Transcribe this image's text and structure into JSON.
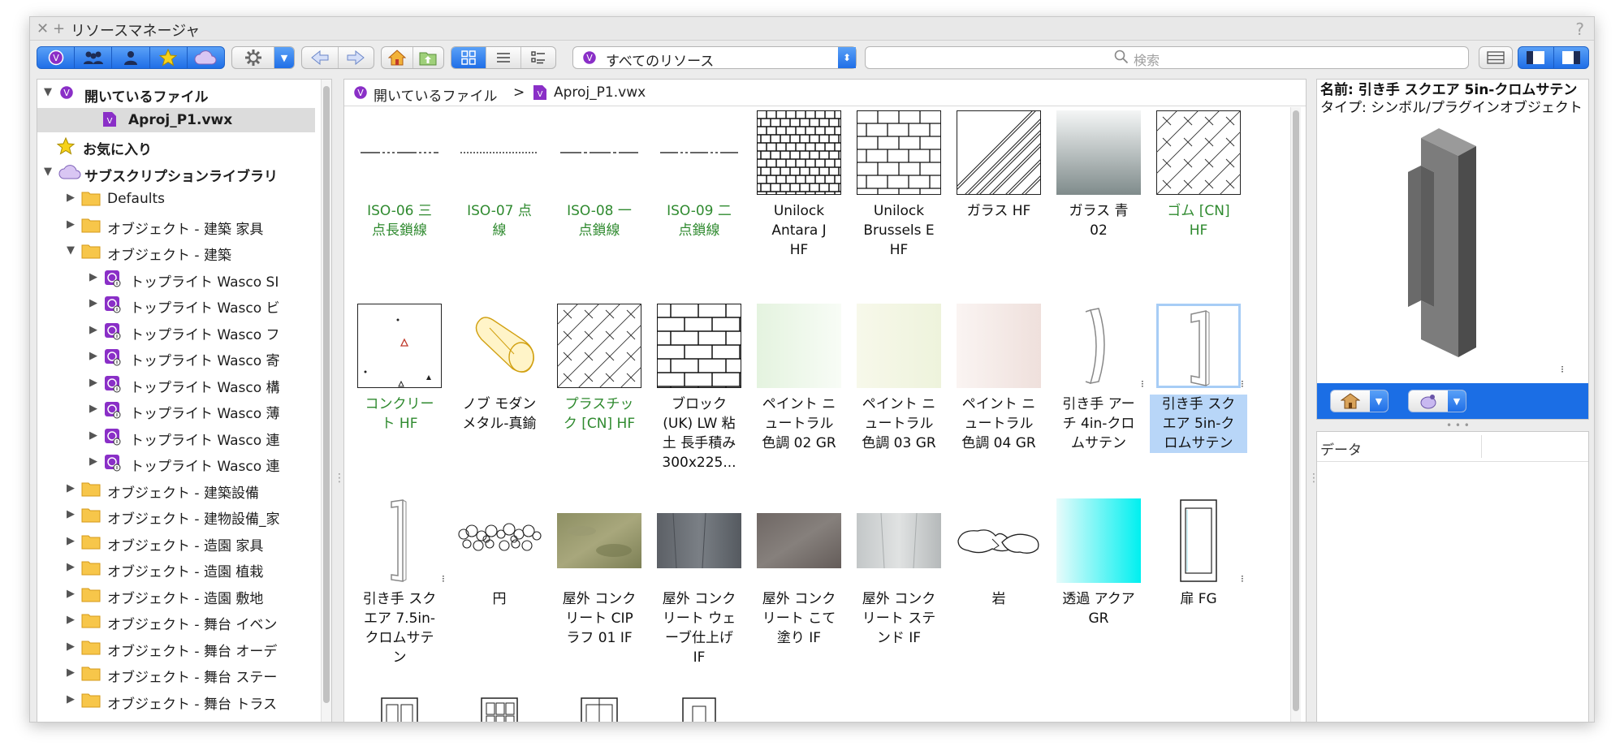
{
  "window": {
    "title": "リソースマネージャ",
    "help": "?"
  },
  "toolbar": {
    "filter_label": "すべてのリソース",
    "search_placeholder": "検索"
  },
  "breadcrumb": {
    "root": "開いているファイル",
    "sep": ">",
    "file": "Aproj_P1.vwx"
  },
  "tree": [
    {
      "label": "開いているファイル",
      "bold": true,
      "level": 0,
      "expanded": true,
      "icon": "vw-file-icon"
    },
    {
      "label": "Aproj_P1.vwx",
      "bold": true,
      "level": 1,
      "selected": true,
      "icon": "vw-doc-icon"
    },
    {
      "label": "お気に入り",
      "bold": true,
      "level": 0,
      "icon": "star-icon"
    },
    {
      "label": "サブスクリプションライブラリ",
      "bold": true,
      "level": 0,
      "expanded": true,
      "icon": "cloud-icon"
    },
    {
      "label": "Defaults",
      "level": 1,
      "icon": "folder-icon"
    },
    {
      "label": "オブジェクト - 建築 家具",
      "level": 1,
      "icon": "folder-icon"
    },
    {
      "label": "オブジェクト - 建築",
      "level": 1,
      "expanded": true,
      "icon": "folder-icon"
    },
    {
      "label": "トップライト Wasco SI",
      "level": 2,
      "icon": "vw-lib-icon"
    },
    {
      "label": "トップライト Wasco ビ",
      "level": 2,
      "icon": "vw-lib-icon"
    },
    {
      "label": "トップライト Wasco フ",
      "level": 2,
      "icon": "vw-lib-icon"
    },
    {
      "label": "トップライト Wasco 寄",
      "level": 2,
      "icon": "vw-lib-icon"
    },
    {
      "label": "トップライト Wasco 構",
      "level": 2,
      "icon": "vw-lib-icon"
    },
    {
      "label": "トップライト Wasco 薄",
      "level": 2,
      "icon": "vw-lib-icon"
    },
    {
      "label": "トップライト Wasco 連",
      "level": 2,
      "icon": "vw-lib-icon"
    },
    {
      "label": "トップライト Wasco 連",
      "level": 2,
      "icon": "vw-lib-icon"
    },
    {
      "label": "オブジェクト - 建築設備",
      "level": 1,
      "icon": "folder-icon"
    },
    {
      "label": "オブジェクト - 建物設備_家",
      "level": 1,
      "icon": "folder-icon"
    },
    {
      "label": "オブジェクト - 造園 家具",
      "level": 1,
      "icon": "folder-icon"
    },
    {
      "label": "オブジェクト - 造園 植栽",
      "level": 1,
      "icon": "folder-icon"
    },
    {
      "label": "オブジェクト - 造園 敷地",
      "level": 1,
      "icon": "folder-icon"
    },
    {
      "label": "オブジェクト - 舞台 イベン",
      "level": 1,
      "icon": "folder-icon"
    },
    {
      "label": "オブジェクト - 舞台 オーデ",
      "level": 1,
      "icon": "folder-icon"
    },
    {
      "label": "オブジェクト - 舞台 ステー",
      "level": 1,
      "icon": "folder-icon"
    },
    {
      "label": "オブジェクト - 舞台 トラス",
      "level": 1,
      "icon": "folder-icon"
    }
  ],
  "resources": [
    {
      "lines": [
        "ISO-06 三",
        "点長鎖線"
      ],
      "green": true,
      "thumb": "line-dash-long"
    },
    {
      "lines": [
        "ISO-07 点",
        "線"
      ],
      "green": true,
      "thumb": "line-dot"
    },
    {
      "lines": [
        "ISO-08 一",
        "点鎖線"
      ],
      "green": true,
      "thumb": "line-dashdot"
    },
    {
      "lines": [
        "ISO-09 二",
        "点鎖線"
      ],
      "green": true,
      "thumb": "line-dashdotdot"
    },
    {
      "lines": [
        "Unilock",
        "Antara J",
        "HF"
      ],
      "thumb": "hatch-stone"
    },
    {
      "lines": [
        "Unilock",
        "Brussels E",
        "HF"
      ],
      "thumb": "hatch-brick"
    },
    {
      "lines": [
        "ガラス HF"
      ],
      "thumb": "hatch-glass"
    },
    {
      "lines": [
        "ガラス 青",
        "02"
      ],
      "thumb": "gradient-gray"
    },
    {
      "lines": [
        "ゴム [CN]",
        "HF"
      ],
      "green": true,
      "thumb": "hatch-cross"
    },
    {
      "lines": [
        "コンクリー",
        "ト HF"
      ],
      "green": true,
      "thumb": "hatch-concrete"
    },
    {
      "lines": [
        "ノブ モダン",
        "メタル-真鍮"
      ],
      "thumb": "knob"
    },
    {
      "lines": [
        "プラスチッ",
        "ク [CN] HF"
      ],
      "green": true,
      "thumb": "hatch-cross"
    },
    {
      "lines": [
        "ブロック",
        "(UK) LW 粘",
        "土 長手積み",
        "300x225..."
      ],
      "thumb": "hatch-block"
    },
    {
      "lines": [
        "ペイント ニ",
        "ュートラル",
        "色調 02 GR"
      ],
      "thumb": "paint-green"
    },
    {
      "lines": [
        "ペイント ニ",
        "ュートラル",
        "色調 03 GR"
      ],
      "thumb": "paint-yellow"
    },
    {
      "lines": [
        "ペイント ニ",
        "ュートラル",
        "色調 04 GR"
      ],
      "thumb": "paint-pink"
    },
    {
      "lines": [
        "引き手 アー",
        "チ 4in-クロ",
        "ムサテン"
      ],
      "thumb": "handle-arch",
      "marker": true
    },
    {
      "lines": [
        "引き手 スク",
        "エア 5in-ク",
        "ロムサテン"
      ],
      "thumb": "handle-square",
      "selected": true,
      "marker": true
    },
    {
      "lines": [
        "引き手 スク",
        "エア 7.5in-",
        "クロムサテ",
        "ン"
      ],
      "thumb": "handle-tall",
      "marker": true
    },
    {
      "lines": [
        "円"
      ],
      "thumb": "circles"
    },
    {
      "lines": [
        "屋外 コンク",
        "リート CIP",
        "ラフ 01 IF"
      ],
      "thumb": "tex-olive"
    },
    {
      "lines": [
        "屋外 コンク",
        "リート ウェ",
        "ーブ仕上げ",
        "IF"
      ],
      "thumb": "tex-dark"
    },
    {
      "lines": [
        "屋外 コンク",
        "リート こて",
        "塗り IF"
      ],
      "thumb": "tex-brown"
    },
    {
      "lines": [
        "屋外 コンク",
        "リート ステ",
        "ンド IF"
      ],
      "thumb": "tex-light"
    },
    {
      "lines": [
        "岩"
      ],
      "thumb": "rocks"
    },
    {
      "lines": [
        "透過 アクア",
        "GR"
      ],
      "thumb": "gradient-aqua"
    },
    {
      "lines": [
        "扉 FG"
      ],
      "thumb": "door",
      "marker": true
    },
    {
      "lines": [],
      "thumb": "window-a"
    },
    {
      "lines": [],
      "thumb": "window-b"
    },
    {
      "lines": [],
      "thumb": "window-c"
    },
    {
      "lines": [],
      "thumb": "window-d"
    }
  ],
  "preview": {
    "name_line": "名前: 引き手 スクエア 5in-クロムサテン",
    "type_line": "タイプ: シンボル/プラグインオブジェクト"
  },
  "data_panel": {
    "header": "データ"
  },
  "colors": {
    "accent_blue": "#1b6ee5",
    "selection": "#b8d6f8",
    "green_text": "#2f8a2f",
    "folder": "#f7c64a",
    "vw_purple": "#8a2fc7"
  }
}
